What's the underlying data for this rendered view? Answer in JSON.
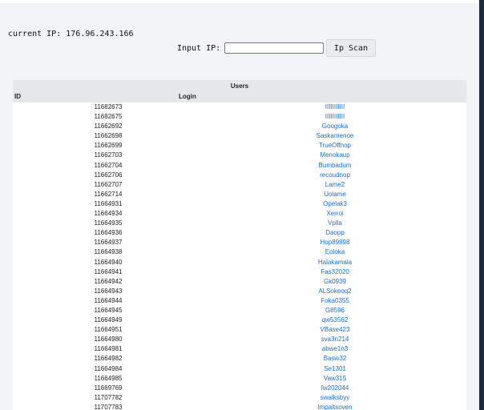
{
  "status": {
    "current_ip_label": "current IP:",
    "current_ip_value": "176.96.243.166"
  },
  "scan": {
    "input_label": "Input IP:",
    "input_value": "",
    "button_label": "Ip Scan"
  },
  "table": {
    "caption": "Users",
    "columns": [
      "ID",
      "Login"
    ],
    "rows": [
      {
        "id": "11682673",
        "login": "IIIIIIIIIII"
      },
      {
        "id": "11682675",
        "login": "IIIIIIIIIII"
      },
      {
        "id": "11662692",
        "login": "Googoka"
      },
      {
        "id": "11662698",
        "login": "Saskamenoe"
      },
      {
        "id": "11662699",
        "login": "TrueOffnop"
      },
      {
        "id": "11662703",
        "login": "Menokaup"
      },
      {
        "id": "11662704",
        "login": "Bumbadum"
      },
      {
        "id": "11662706",
        "login": "recoudnop"
      },
      {
        "id": "11662707",
        "login": "Lame2"
      },
      {
        "id": "11662714",
        "login": "Uolame"
      },
      {
        "id": "11664931",
        "login": "Opelak3"
      },
      {
        "id": "11664934",
        "login": "Xerroi"
      },
      {
        "id": "11664935",
        "login": "Vplla"
      },
      {
        "id": "11664936",
        "login": "Daopp"
      },
      {
        "id": "11664937",
        "login": "Hop89898"
      },
      {
        "id": "11664938",
        "login": "Eoloka"
      },
      {
        "id": "11664940",
        "login": "Halakamala"
      },
      {
        "id": "11664941",
        "login": "Fas32020"
      },
      {
        "id": "11664942",
        "login": "Gk0939"
      },
      {
        "id": "11664943",
        "login": "ALSokeoq2"
      },
      {
        "id": "11664944",
        "login": "Foka0355"
      },
      {
        "id": "11664945",
        "login": "G8596"
      },
      {
        "id": "11664949",
        "login": "qw53562"
      },
      {
        "id": "11664951",
        "login": "VBase423"
      },
      {
        "id": "11664980",
        "login": "sva3n214"
      },
      {
        "id": "11664981",
        "login": "abwe1n3"
      },
      {
        "id": "11664982",
        "login": "Basw32"
      },
      {
        "id": "11664984",
        "login": "Se1301"
      },
      {
        "id": "11664985",
        "login": "Vaw315"
      },
      {
        "id": "11669769",
        "login": "fw202044"
      },
      {
        "id": "11707782",
        "login": "swalksbyy"
      },
      {
        "id": "11707783",
        "login": "Impaltsoven"
      }
    ]
  }
}
